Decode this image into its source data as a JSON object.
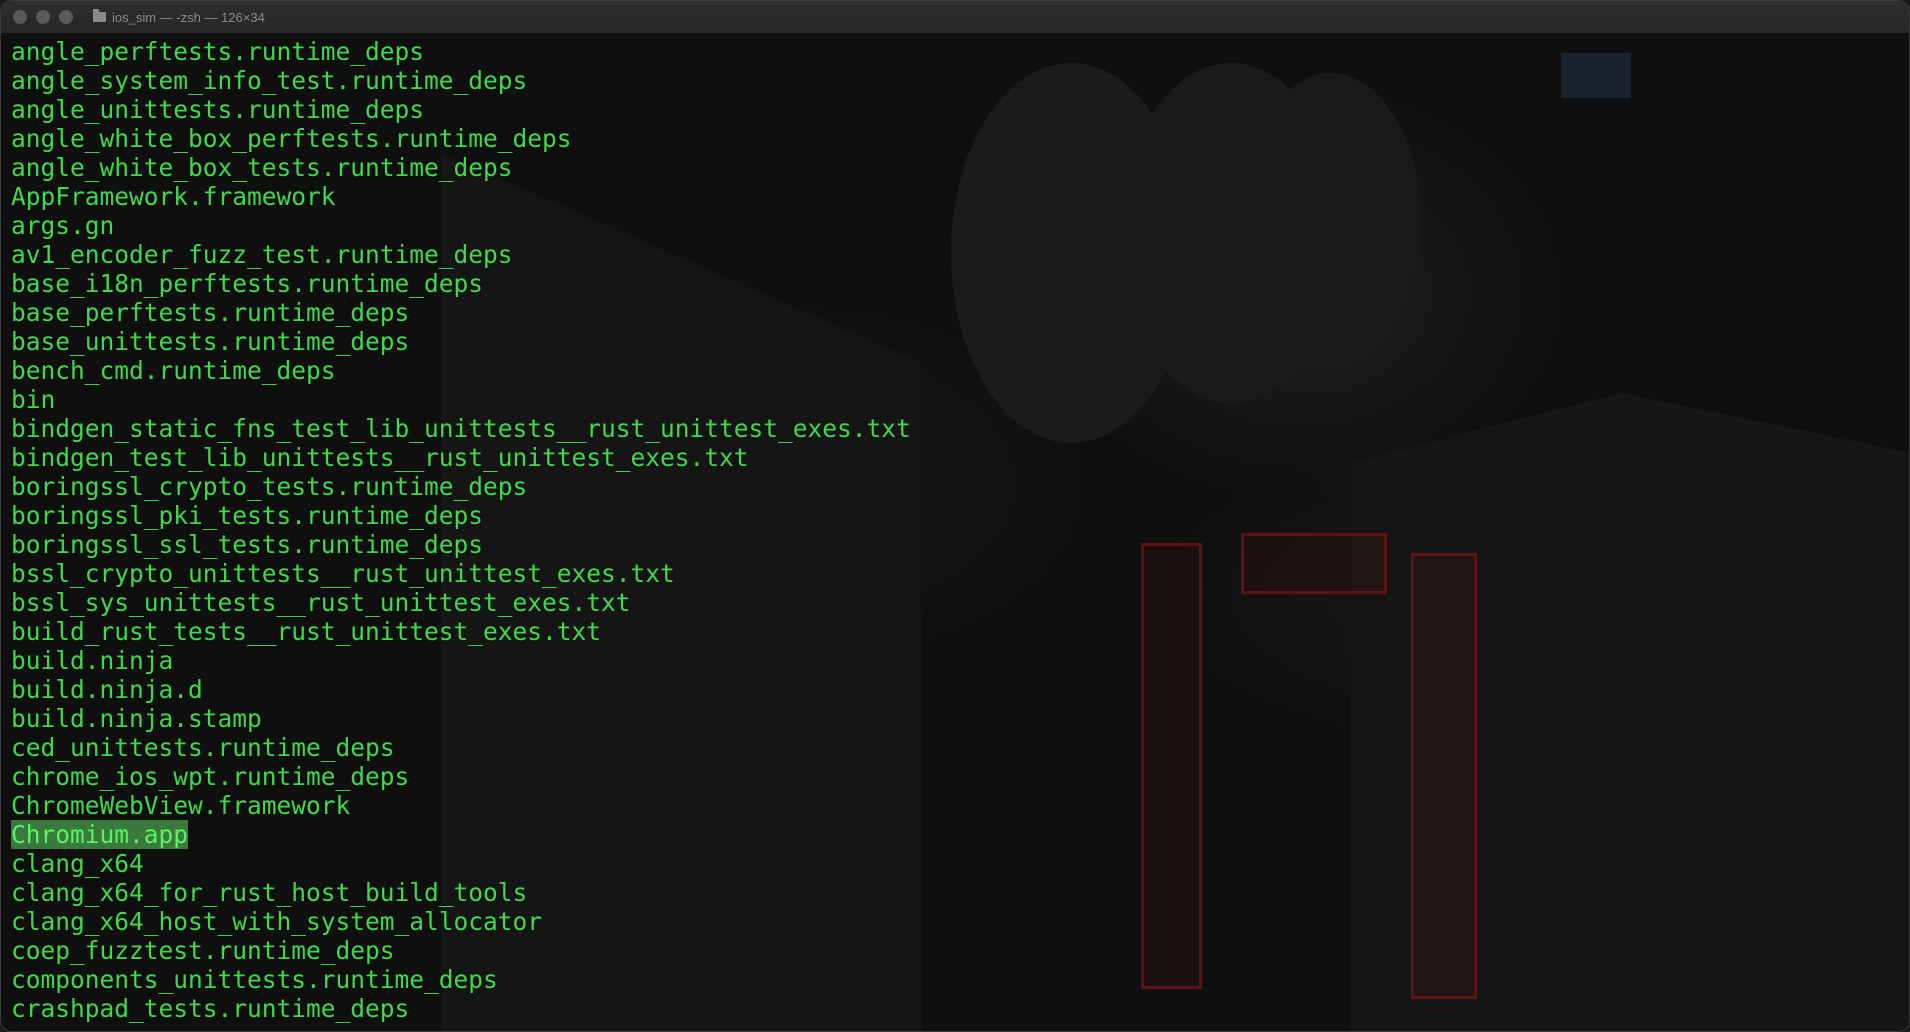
{
  "window": {
    "title": "ios_sim — -zsh — 126×34"
  },
  "terminal": {
    "text_color": "#3fd94a",
    "highlight_color": "#3a7a3c",
    "lines": [
      "angle_perftests.runtime_deps",
      "angle_system_info_test.runtime_deps",
      "angle_unittests.runtime_deps",
      "angle_white_box_perftests.runtime_deps",
      "angle_white_box_tests.runtime_deps",
      "AppFramework.framework",
      "args.gn",
      "av1_encoder_fuzz_test.runtime_deps",
      "base_i18n_perftests.runtime_deps",
      "base_perftests.runtime_deps",
      "base_unittests.runtime_deps",
      "bench_cmd.runtime_deps",
      "bin",
      "bindgen_static_fns_test_lib_unittests__rust_unittest_exes.txt",
      "bindgen_test_lib_unittests__rust_unittest_exes.txt",
      "boringssl_crypto_tests.runtime_deps",
      "boringssl_pki_tests.runtime_deps",
      "boringssl_ssl_tests.runtime_deps",
      "bssl_crypto_unittests__rust_unittest_exes.txt",
      "bssl_sys_unittests__rust_unittest_exes.txt",
      "build_rust_tests__rust_unittest_exes.txt",
      "build.ninja",
      "build.ninja.d",
      "build.ninja.stamp",
      "ced_unittests.runtime_deps",
      "chrome_ios_wpt.runtime_deps",
      "ChromeWebView.framework",
      "Chromium.app",
      "clang_x64",
      "clang_x64_for_rust_host_build_tools",
      "clang_x64_host_with_system_allocator",
      "coep_fuzztest.runtime_deps",
      "components_unittests.runtime_deps",
      "crashpad_tests.runtime_deps"
    ],
    "selected_line": "Chromium.app"
  }
}
